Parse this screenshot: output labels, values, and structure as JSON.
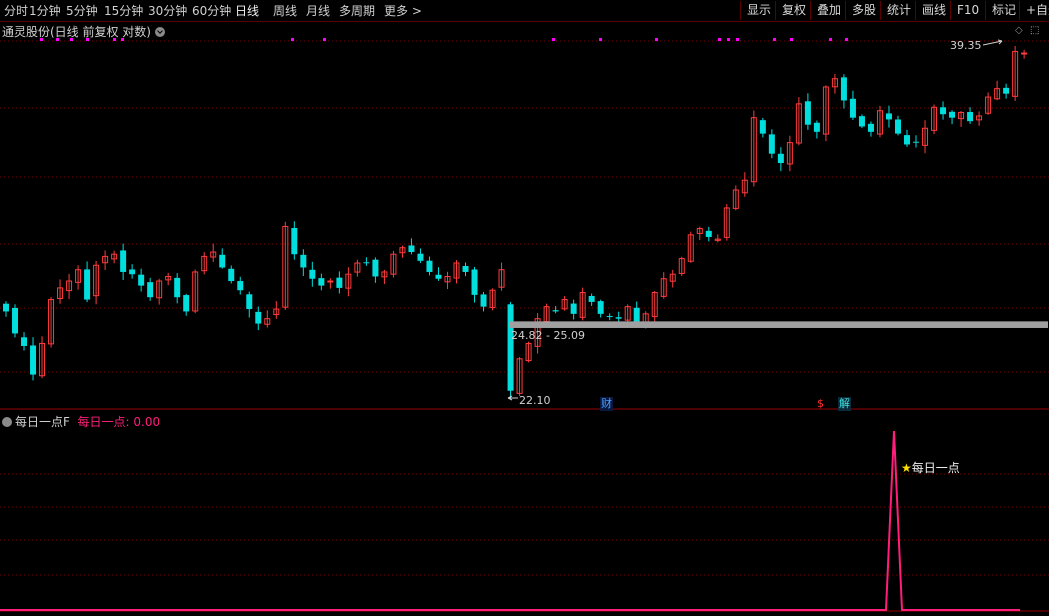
{
  "toolbar": {
    "periods": [
      {
        "label": "分时"
      },
      {
        "label": "1分钟"
      },
      {
        "label": "5分钟"
      },
      {
        "label": "15分钟"
      },
      {
        "label": "30分钟"
      },
      {
        "label": "60分钟"
      },
      {
        "label": "日线"
      },
      {
        "label": "周线"
      },
      {
        "label": "月线"
      },
      {
        "label": "多周期"
      },
      {
        "label": "更多 >"
      }
    ],
    "active_period": "日线",
    "right_buttons": [
      {
        "label": "显示"
      },
      {
        "label": "复权"
      },
      {
        "label": "叠加"
      },
      {
        "label": "多股"
      },
      {
        "label": "统计"
      },
      {
        "label": "画线"
      },
      {
        "label": "F10"
      },
      {
        "label": "标记"
      },
      {
        "label": "+自选"
      }
    ]
  },
  "main_chart": {
    "title": "通灵股份(日线 前复权 对数)",
    "high_label": "39.35",
    "low_label": "22.10",
    "range_label": "24.82 - 25.09",
    "markers": [
      {
        "text": "财",
        "color": "#4da0ff"
      },
      {
        "text": "$",
        "color": "#ff3030"
      },
      {
        "text": "解",
        "color": "#40e0e0"
      }
    ]
  },
  "sub_chart": {
    "indicator_name": "每日一点F",
    "series_label": "每日一点:",
    "series_value": "0.00",
    "signal_label": "每日一点"
  },
  "colors": {
    "up": "#ff3c3c",
    "down": "#00dede",
    "grid": "#7a0000",
    "indicator": "#ff1e7a",
    "marker_dot": "#ff00ff"
  },
  "chart_data": {
    "type": "candlestick",
    "low": 22.1,
    "high": 39.35,
    "y_scale": "log",
    "gap_range": [
      24.82,
      25.09
    ],
    "closes_approx": [
      25.5,
      24.6,
      24.1,
      23.0,
      24.2,
      26.0,
      26.5,
      26.8,
      27.3,
      26.0,
      27.5,
      27.9,
      28.0,
      27.2,
      27.1,
      26.6,
      26.1,
      26.8,
      27.0,
      26.1,
      25.5,
      27.2,
      27.9,
      28.1,
      27.4,
      26.8,
      26.4,
      25.6,
      25.0,
      25.2,
      25.6,
      29.3,
      28.0,
      27.4,
      26.9,
      26.6,
      26.8,
      26.5,
      27.1,
      27.6,
      27.6,
      27.0,
      27.2,
      28.0,
      28.3,
      28.1,
      27.7,
      27.2,
      26.9,
      27.0,
      27.6,
      27.2,
      26.2,
      25.7,
      26.4,
      27.3,
      22.4,
      23.6,
      24.2,
      25.2,
      25.7,
      25.5,
      26.0,
      25.4,
      26.3,
      25.9,
      25.4,
      25.3,
      25.2,
      25.7,
      24.9,
      25.4,
      26.3,
      26.9,
      27.1,
      27.8,
      28.9,
      29.2,
      28.8,
      28.7,
      30.2,
      31.1,
      31.6,
      35.0,
      34.1,
      33.0,
      32.5,
      33.6,
      35.8,
      34.6,
      34.2,
      36.8,
      37.3,
      36.0,
      35.0,
      34.5,
      34.2,
      35.4,
      34.9,
      34.1,
      33.5,
      33.6,
      34.4,
      35.6,
      35.2,
      35.0,
      35.3,
      34.8,
      35.1,
      36.2,
      36.7,
      36.4,
      39.0,
      38.9
    ]
  }
}
